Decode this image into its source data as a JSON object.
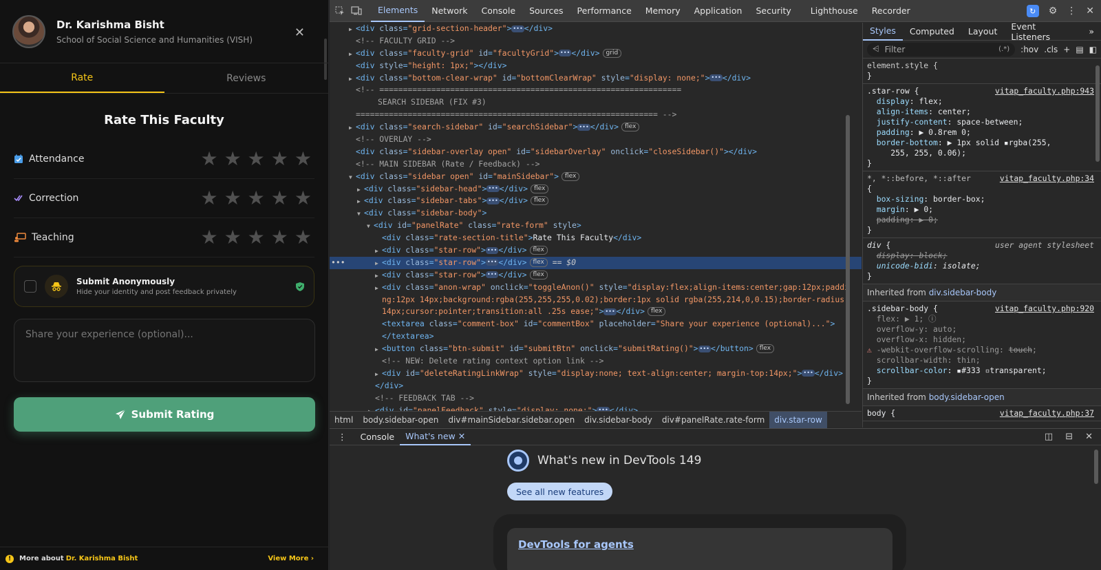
{
  "app": {
    "name": "Dr. Karishma Bisht",
    "school": "School of Social Science and Humanities (VISH)",
    "tabs": [
      "Rate",
      "Reviews"
    ],
    "section_title": "Rate This Faculty",
    "ratings": [
      {
        "label": "Attendance",
        "icon": "calendar-check-icon",
        "stars": 0
      },
      {
        "label": "Correction",
        "icon": "double-check-icon",
        "stars": 0
      },
      {
        "label": "Teaching",
        "icon": "teaching-icon",
        "stars": 0
      }
    ],
    "anon_title": "Submit Anonymously",
    "anon_sub": "Hide your identity and post feedback privately",
    "comment_placeholder": "Share your experience (optional)...",
    "submit_label": "Submit Rating",
    "footer_more": "More about",
    "footer_name": "Dr. Karishma Bisht",
    "footer_view": "View More",
    "accent": "#f5c518",
    "submit_color": "#4fa07a"
  },
  "devtools": {
    "tabs": [
      "Elements",
      "Network",
      "Console",
      "Sources",
      "Performance",
      "Memory",
      "Application",
      "Security",
      "Lighthouse",
      "Recorder"
    ],
    "breadcrumbs": [
      "html",
      "body.sidebar-open",
      "div#mainSidebar.sidebar.open",
      "div.sidebar-body",
      "div#panelRate.rate-form",
      "div.star-row"
    ],
    "styles_tabs": [
      "Styles",
      "Computed",
      "Layout",
      "Event Listeners"
    ],
    "filter_placeholder": "Filter",
    "filter_tools": [
      ":hov",
      ".cls"
    ],
    "inherited_sidebar_label": "Inherited from",
    "inherited_sidebar_target": "div.sidebar-body",
    "inherited_body_label": "Inherited from",
    "inherited_body_target": "body.sidebar-open",
    "user_agent_label": "user agent stylesheet",
    "drawer_tabs": [
      "Console",
      "What's new"
    ],
    "whats_new_title": "What's new in DevTools 149",
    "see_all": "See all new features",
    "card_link": "DevTools for agents"
  }
}
